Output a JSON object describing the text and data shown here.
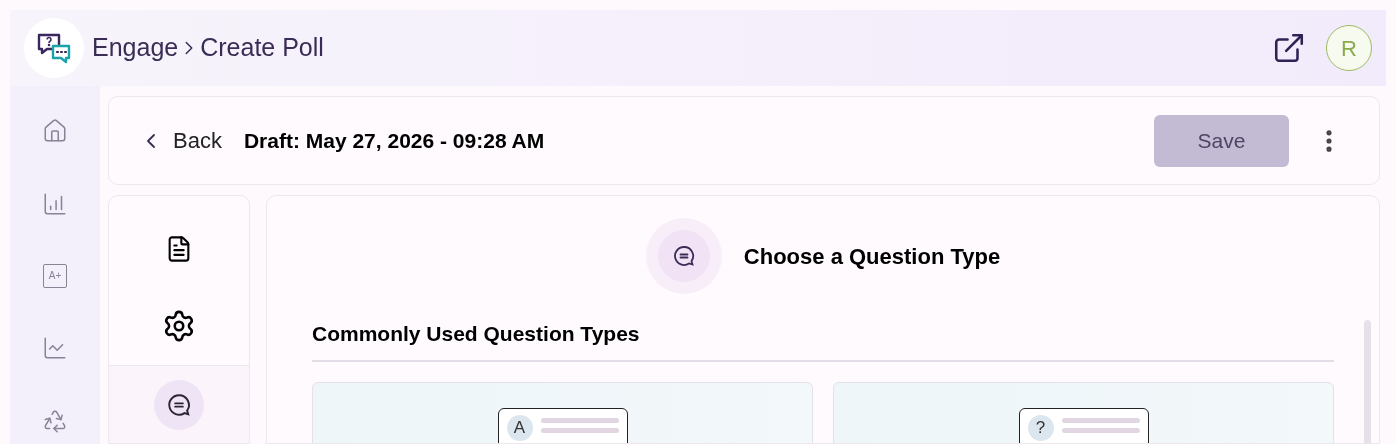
{
  "header": {
    "breadcrumb": [
      {
        "label": "Engage"
      },
      {
        "label": "Create Poll"
      }
    ],
    "avatar": "R"
  },
  "nav": [
    {
      "kind": "home"
    },
    {
      "kind": "chart"
    },
    {
      "kind": "grade",
      "label": "A+"
    },
    {
      "kind": "trend"
    },
    {
      "kind": "recycle"
    }
  ],
  "toolbar": {
    "back": "Back",
    "draft": "Draft: May 27, 2026 - 09:28 AM",
    "save": {
      "label": "Save",
      "disabled": true
    }
  },
  "sections": [
    {
      "kind": "document",
      "selected": false
    },
    {
      "kind": "settings",
      "selected": false
    },
    {
      "kind": "questions",
      "selected": true
    }
  ],
  "main": {
    "title": "Choose a Question Type",
    "subtitle": "Commonly Used Question Types",
    "cards": [
      {
        "marker": "A"
      },
      {
        "marker": "?"
      }
    ]
  }
}
